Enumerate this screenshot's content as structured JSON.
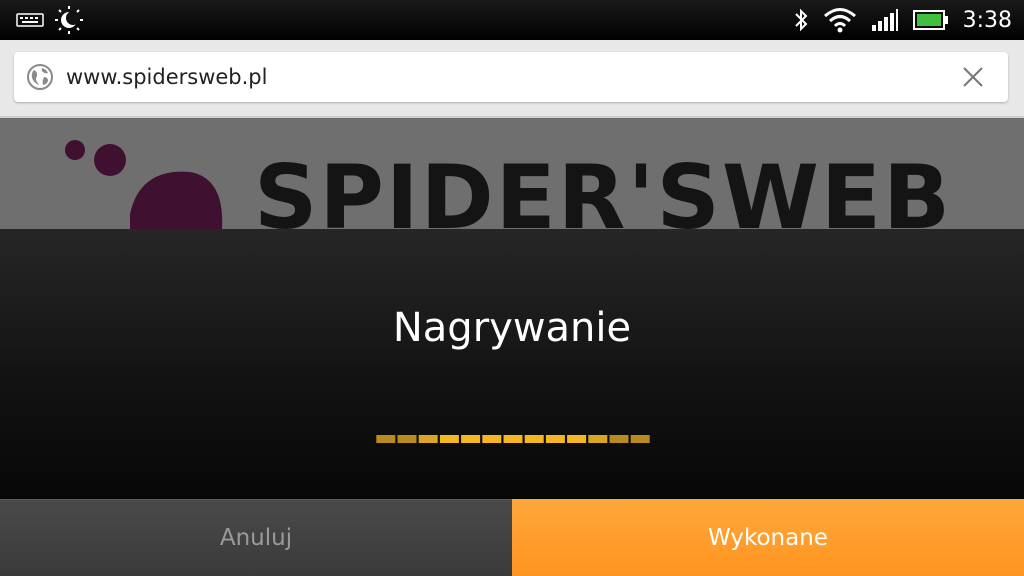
{
  "status_bar": {
    "time": "3:38",
    "left_icons": [
      "keyboard-icon",
      "weather-icon"
    ],
    "right_icons": [
      "bluetooth-icon",
      "wifi-icon",
      "signal-icon",
      "battery-icon"
    ]
  },
  "browser": {
    "url": "www.spidersweb.pl",
    "page_logo_text": "SPIDER'SWEB"
  },
  "dialog": {
    "title": "Nagrywanie",
    "level_meter": {
      "segments_total": 13,
      "segments_active": 13
    },
    "cancel_label": "Anuluj",
    "done_label": "Wykonane"
  },
  "colors": {
    "accent": "#ff9a28",
    "meter_on": "#f4b623",
    "logo_purple": "#3f1030"
  }
}
